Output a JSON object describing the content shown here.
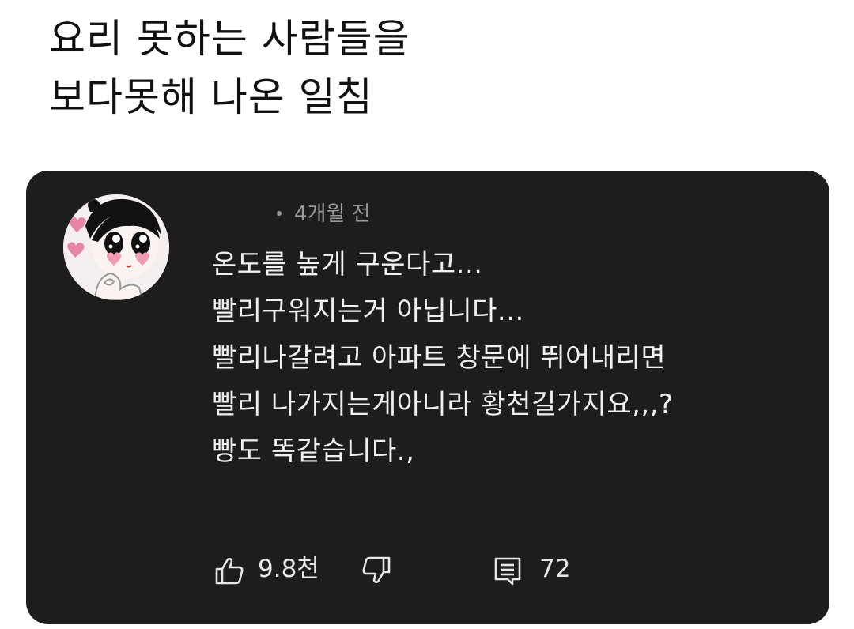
{
  "post": {
    "title_line1": "요리 못하는 사람들을",
    "title_line2": "보다못해 나온 일침"
  },
  "comment": {
    "timestamp": "4개월 전",
    "lines": [
      "온도를 높게 구운다고...",
      "빨리구워지는거 아닙니다...",
      "빨리나갈려고 아파트 창문에 뛰어내리면",
      "빨리 나가지는게아니라 황천길가지요,,,?",
      "빵도 똑같습니다.,"
    ],
    "likes": "9.8천",
    "replies": "72",
    "icons": {
      "like": "thumbs-up-icon",
      "dislike": "thumbs-down-icon",
      "reply": "comment-icon"
    }
  },
  "colors": {
    "card_background": "#1d1d1d",
    "comment_text": "#f0f0f0",
    "meta_text": "#9a9a9a",
    "title_text": "#111111"
  }
}
